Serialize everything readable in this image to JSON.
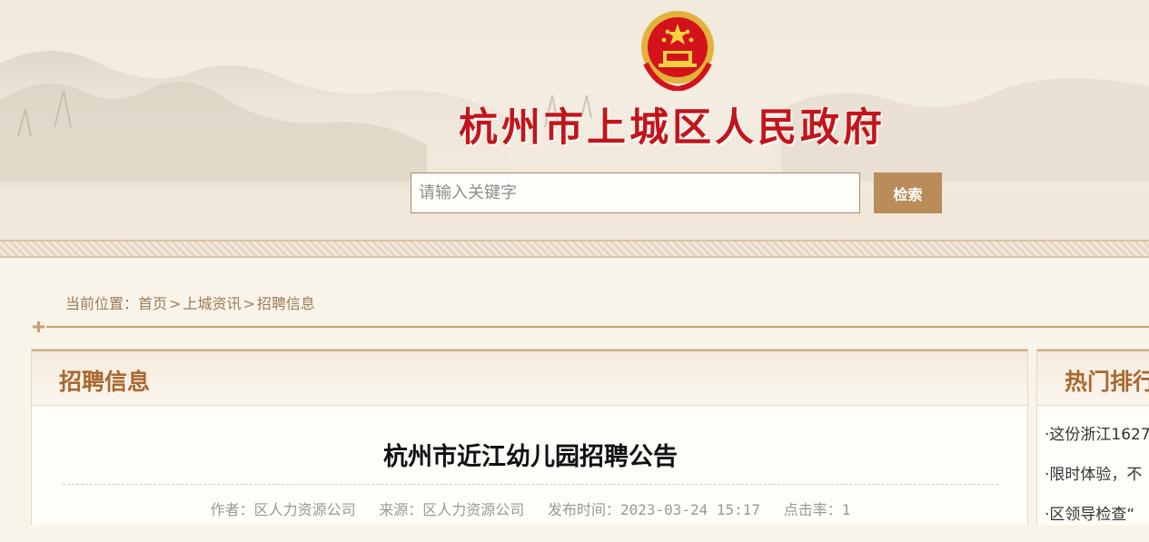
{
  "header": {
    "site_title": "杭州市上城区人民政府",
    "search_placeholder": "请输入关键字",
    "search_button": "检索"
  },
  "breadcrumb": {
    "prefix": "当前位置：",
    "items": [
      "首页",
      "上城资讯",
      "招聘信息"
    ],
    "separator": ">"
  },
  "main": {
    "section_title": "招聘信息",
    "article_title": "杭州市近江幼儿园招聘公告",
    "meta": {
      "author": "作者：区人力资源公司",
      "source": "来源：区人力资源公司",
      "published": "发布时间：2023-03-24 15:17",
      "hits": "点击率：1"
    }
  },
  "sidebar": {
    "title": "热门排行",
    "items": [
      "·这份浙江1627",
      "·限时体验，不",
      "·区领导检查“"
    ]
  },
  "colors": {
    "title_red": "#c2151b",
    "accent_brown": "#b98c5a",
    "section_title": "#a9682e",
    "breadcrumb": "#9c7b58"
  },
  "icons": {
    "emblem": "national-emblem-icon",
    "divider": "ornament-icon"
  }
}
